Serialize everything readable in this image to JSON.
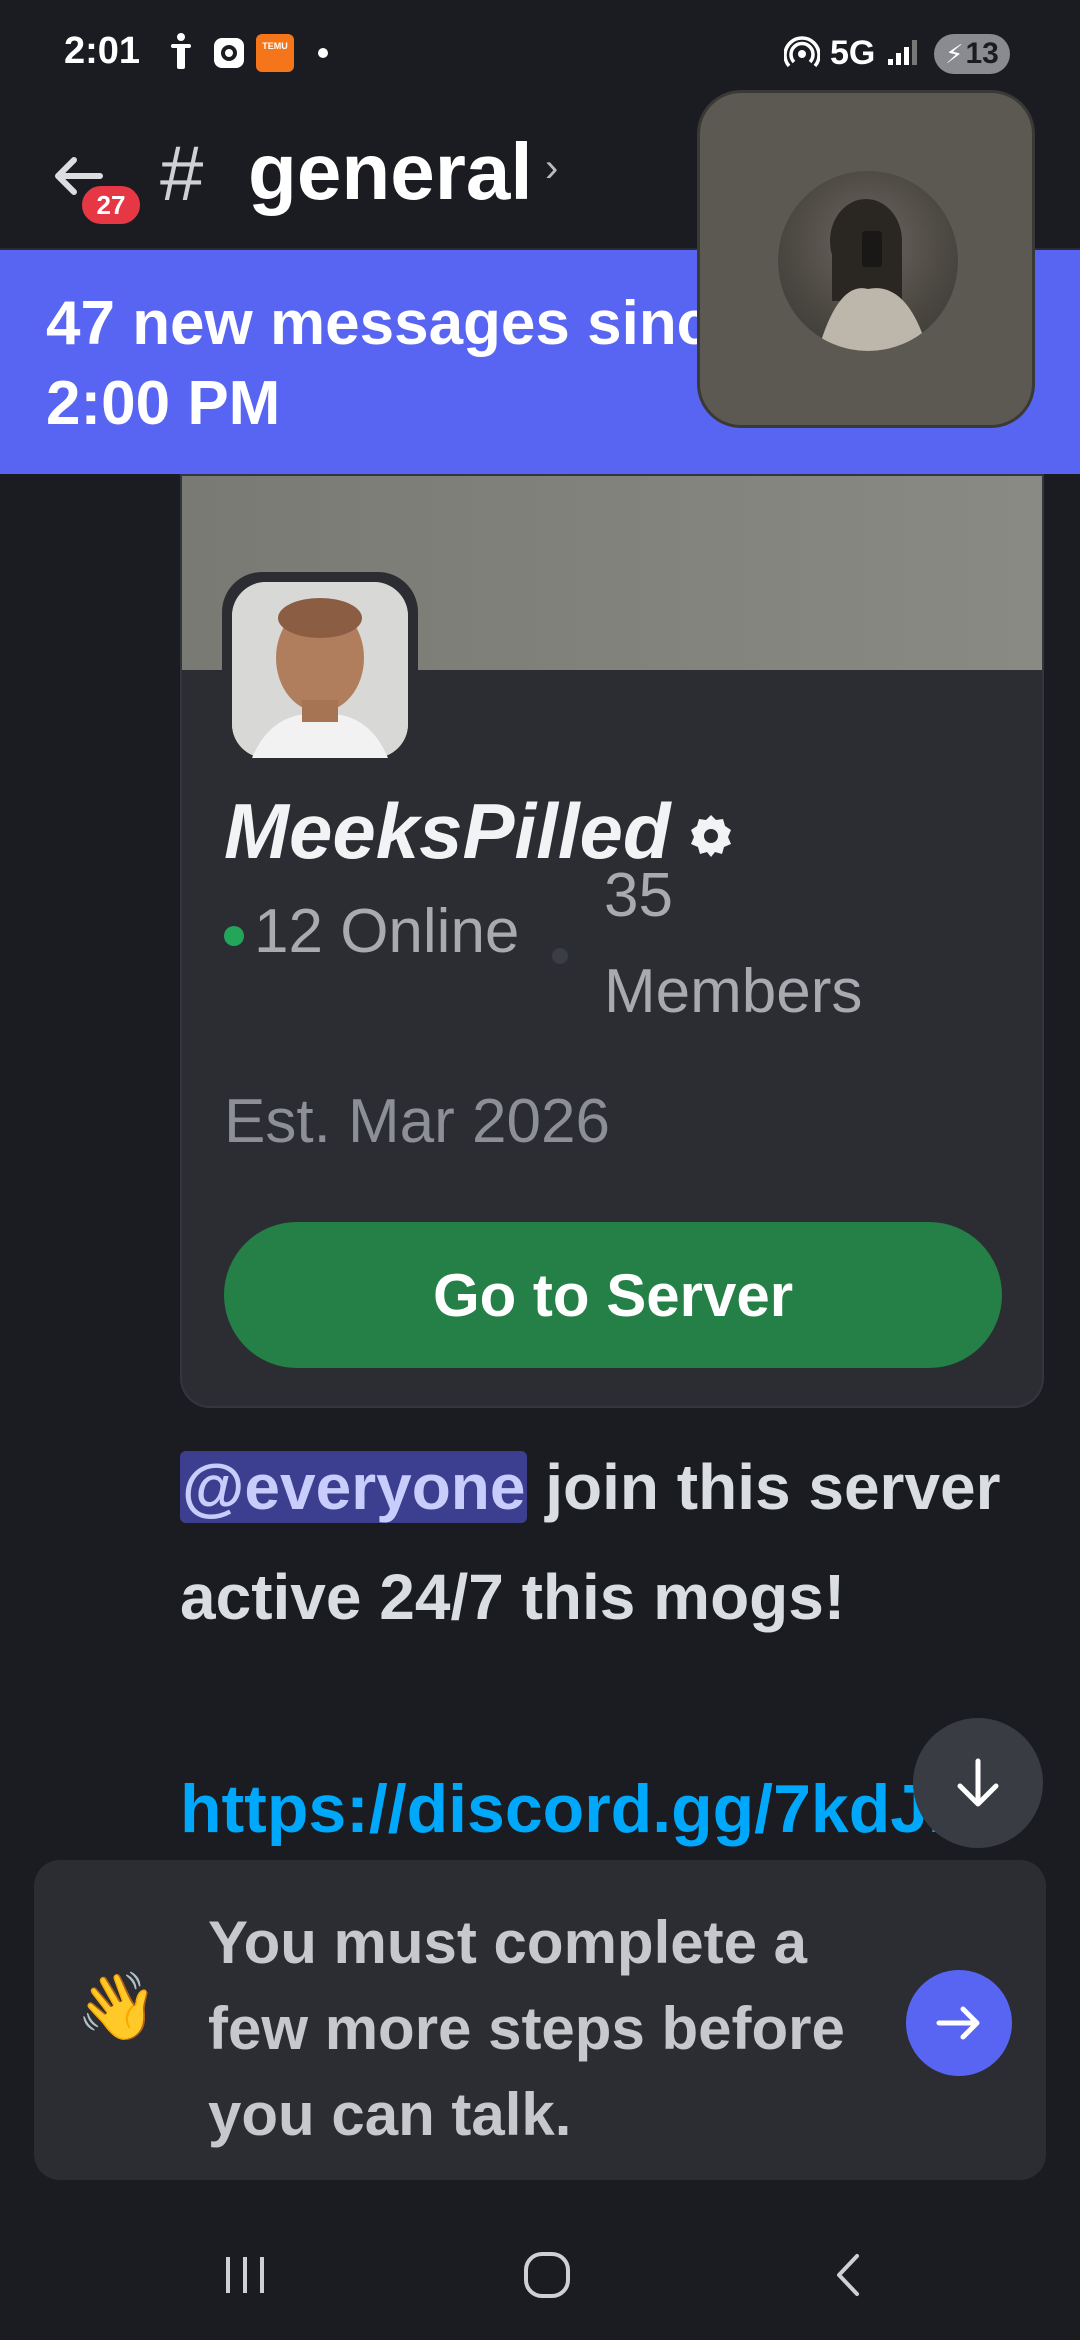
{
  "status_bar": {
    "time": "2:01",
    "temu_label": "TEMU",
    "network": "5G",
    "battery": "13"
  },
  "header": {
    "unread_count": "27",
    "channel_hash": "#",
    "channel_name": "general",
    "chevron": "›"
  },
  "banner": {
    "line1": "47 new messages since",
    "line2": "2:00 PM"
  },
  "invite_card": {
    "server_name": "MeeksPilled",
    "online_count": "12 Online",
    "member_count": "35 Members",
    "established": "Est. Mar 2026",
    "button_label": "Go to Server"
  },
  "message": {
    "mention": "@everyone",
    "text": " join this server active 24/7 this mogs!",
    "link": "https://discord.gg/7kdJ1"
  },
  "composer": {
    "emoji": "👋",
    "notice": "You must complete a few more steps before you can talk."
  },
  "colors": {
    "blurple": "#5865f2",
    "green_button": "#248046",
    "online_dot": "#23a55a",
    "link": "#00a8fc",
    "badge_red": "#e53844"
  },
  "icons": {
    "back": "arrow-left-icon",
    "verified": "verified-badge-icon",
    "jump": "arrow-down-icon",
    "send": "arrow-right-icon"
  }
}
